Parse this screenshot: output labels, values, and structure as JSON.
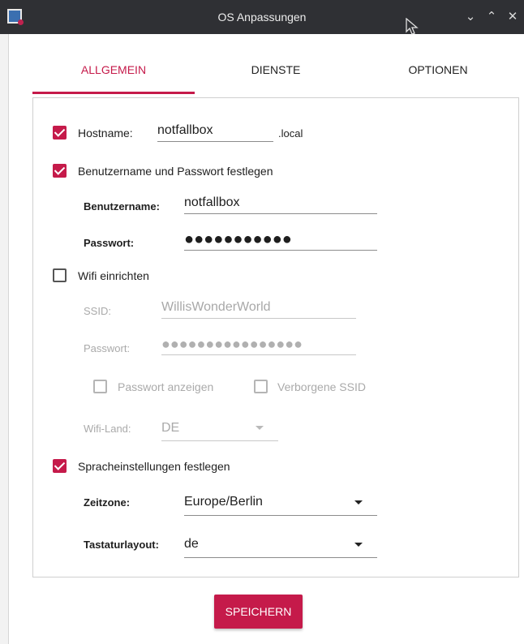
{
  "window": {
    "title": "OS Anpassungen",
    "minimize_icon": "chevron-down-icon",
    "maximize_icon": "chevron-up-icon",
    "close_icon": "close-icon",
    "minimize_glyph": "⌄",
    "maximize_glyph": "⌃",
    "close_glyph": "✕"
  },
  "tabs": [
    {
      "label": "ALLGEMEIN",
      "active": true
    },
    {
      "label": "DIENSTE",
      "active": false
    },
    {
      "label": "OPTIONEN",
      "active": false
    }
  ],
  "accent_color": "#c51a4a",
  "hostname": {
    "checked": true,
    "label": "Hostname:",
    "value": "notfallbox",
    "suffix": ".local"
  },
  "user": {
    "checked": true,
    "label": "Benutzername und Passwort festlegen",
    "username_label": "Benutzername:",
    "username_value": "notfallbox",
    "password_label": "Passwort:",
    "password_masked": "●●●●●●●●●●●"
  },
  "wifi": {
    "checked": false,
    "label": "Wifi einrichten",
    "ssid_label": "SSID:",
    "ssid_value": "WillisWonderWorld",
    "password_label": "Passwort:",
    "password_masked": "●●●●●●●●●●●●●●●●",
    "show_password_label": "Passwort anzeigen",
    "hidden_ssid_label": "Verborgene SSID",
    "country_label": "Wifi-Land:",
    "country_value": "DE"
  },
  "locale": {
    "checked": true,
    "label": "Spracheinstellungen festlegen",
    "timezone_label": "Zeitzone:",
    "timezone_value": "Europe/Berlin",
    "keyboard_label": "Tastaturlayout:",
    "keyboard_value": "de"
  },
  "save_label": "SPEICHERN"
}
